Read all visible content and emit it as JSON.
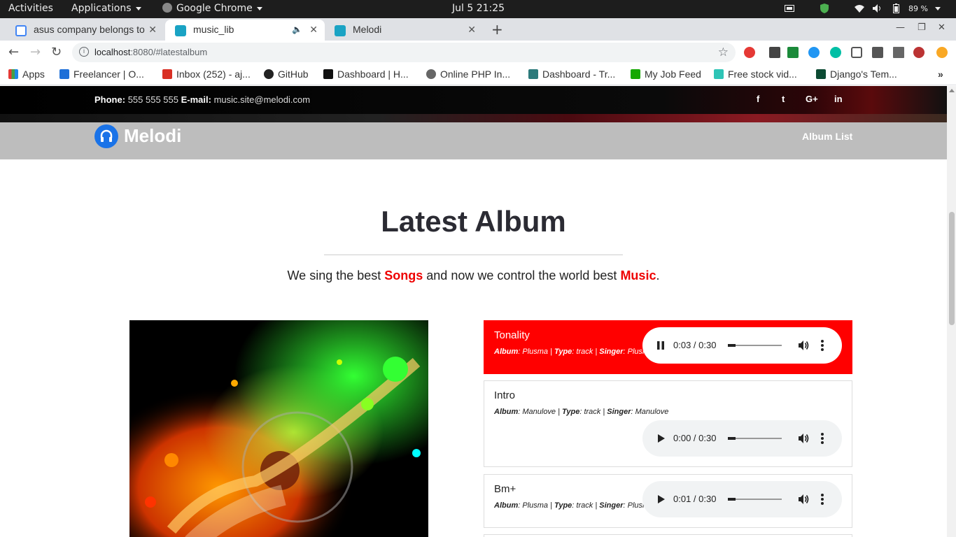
{
  "system": {
    "activities": "Activities",
    "applications": "Applications",
    "app": "Google Chrome",
    "clock": "Jul 5  21:25",
    "battery": "89 %"
  },
  "tabs": [
    {
      "label": "asus company belongs to"
    },
    {
      "label": "music_lib"
    },
    {
      "label": "Melodi"
    }
  ],
  "address": {
    "host": "localhost",
    "rest": ":8080/#latestalbum"
  },
  "bookmarks": [
    {
      "label": "Apps",
      "color": "#e04b3c"
    },
    {
      "label": "Freelancer | O...",
      "color": "#1d6fd8"
    },
    {
      "label": "Inbox (252) - aj...",
      "color": "#d93025"
    },
    {
      "label": "GitHub",
      "color": "#222222"
    },
    {
      "label": "Dashboard | H...",
      "color": "#111111"
    },
    {
      "label": "Online PHP In...",
      "color": "#666666"
    },
    {
      "label": "Dashboard - Tr...",
      "color": "#2c7a7b"
    },
    {
      "label": "My Job Feed",
      "color": "#14a800"
    },
    {
      "label": "Free stock vid...",
      "color": "#2ec4b6"
    },
    {
      "label": "Django's Tem...",
      "color": "#0c4b33"
    }
  ],
  "site": {
    "phone_label": "Phone",
    "phone": "555 555 555",
    "email_label": "E-mail",
    "email": "music.site@melodi.com",
    "social": [
      "f",
      "t",
      "G+",
      "in"
    ],
    "logo": "Melodi",
    "nav_link": "Album List"
  },
  "section": {
    "title": "Latest Album",
    "sub_before": "We sing the best ",
    "sub_hl1": "Songs",
    "sub_mid": " and now we control the world best ",
    "sub_hl2": "Music",
    "sub_after": "."
  },
  "tracks": [
    {
      "name": "Tonality",
      "album": "Plusma",
      "type": "track",
      "singer": "Plusma",
      "time": "0:03 / 0:30",
      "progress": 0.1,
      "state": "playing"
    },
    {
      "name": "Intro",
      "album": "Manulove",
      "type": "track",
      "singer": "Manulove",
      "time": "0:00 / 0:30",
      "progress": 0.0,
      "state": "paused"
    },
    {
      "name": "Bm+",
      "album": "Plusma",
      "type": "track",
      "singer": "Plusma",
      "time": "0:01 / 0:30",
      "progress": 0.04,
      "state": "paused"
    }
  ],
  "meta_labels": {
    "album": "Album",
    "type": "Type",
    "singer": "Singer"
  },
  "colors": {
    "accent": "#ff0000",
    "navbar": "#bdbdbd",
    "logo": "#1a73e8"
  }
}
